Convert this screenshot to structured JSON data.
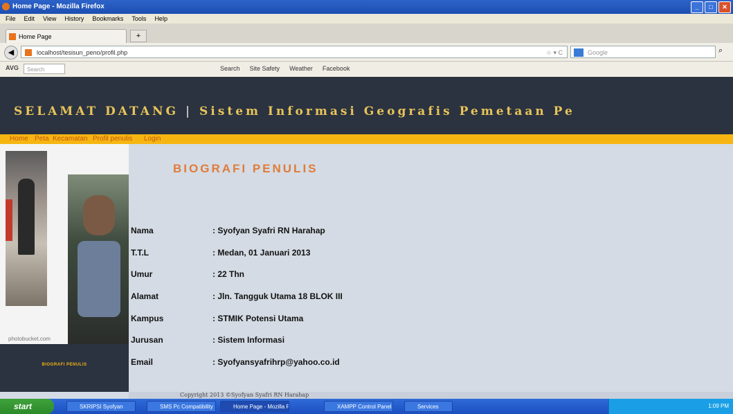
{
  "browser": {
    "window_title": "Home Page - Mozilla Firefox",
    "menu": [
      "File",
      "Edit",
      "View",
      "History",
      "Bookmarks",
      "Tools",
      "Help"
    ],
    "tab_title": "Home Page",
    "new_tab": "+",
    "url": "localhost/tesisun_peno/profil.php",
    "search_placeholder": "Google",
    "addon_label": "AVG",
    "addon_search_placeholder": "Search",
    "addon_items": [
      "Search",
      "Site Safety",
      "Weather",
      "Facebook"
    ]
  },
  "site": {
    "title_left": "SELAMAT DATANG",
    "title_divider": "|",
    "title_right": "Sistem Informasi Geografis Pemetaan Pe",
    "nav": [
      "Home",
      "Peta",
      "Kecamatan",
      "Profil penulis",
      "Login"
    ]
  },
  "sidebar": {
    "watermark": "photobucket.com",
    "bottom_label": "BIOGRAFI PENULIS"
  },
  "main": {
    "heading": "BIOGRAFI PENULIS",
    "fields": [
      {
        "label": "Nama",
        "value": ": Syofyan Syafri RN Harahap"
      },
      {
        "label": "T.T.L",
        "value": ": Medan, 01 Januari 2013"
      },
      {
        "label": "Umur",
        "value": ": 22 Thn"
      },
      {
        "label": "Alamat",
        "value": ": Jln. Tangguk Utama 18 BLOK III"
      },
      {
        "label": "Kampus",
        "value": ": STMIK Potensi Utama"
      },
      {
        "label": "Jurusan",
        "value": ": Sistem Informasi"
      },
      {
        "label": "Email",
        "value": ": Syofyansyafrihrp@yahoo.co.id"
      }
    ]
  },
  "footer": {
    "text": "Copyright 2013 ©Syofyan Syafri RN Harahap"
  },
  "taskbar": {
    "start": "start",
    "tasks": [
      "SKRIPSI Syofyan",
      "SMS Pc Compatibility",
      "Home Page - Mozilla F...",
      "XAMPP Control Panel",
      "Services"
    ],
    "clock": "1:09 PM"
  },
  "colors": {
    "header_bg": "#2b3340",
    "nav_strip": "#f7b512",
    "heading_accent": "#e07b3a",
    "content_bg": "#d4dbe4"
  }
}
